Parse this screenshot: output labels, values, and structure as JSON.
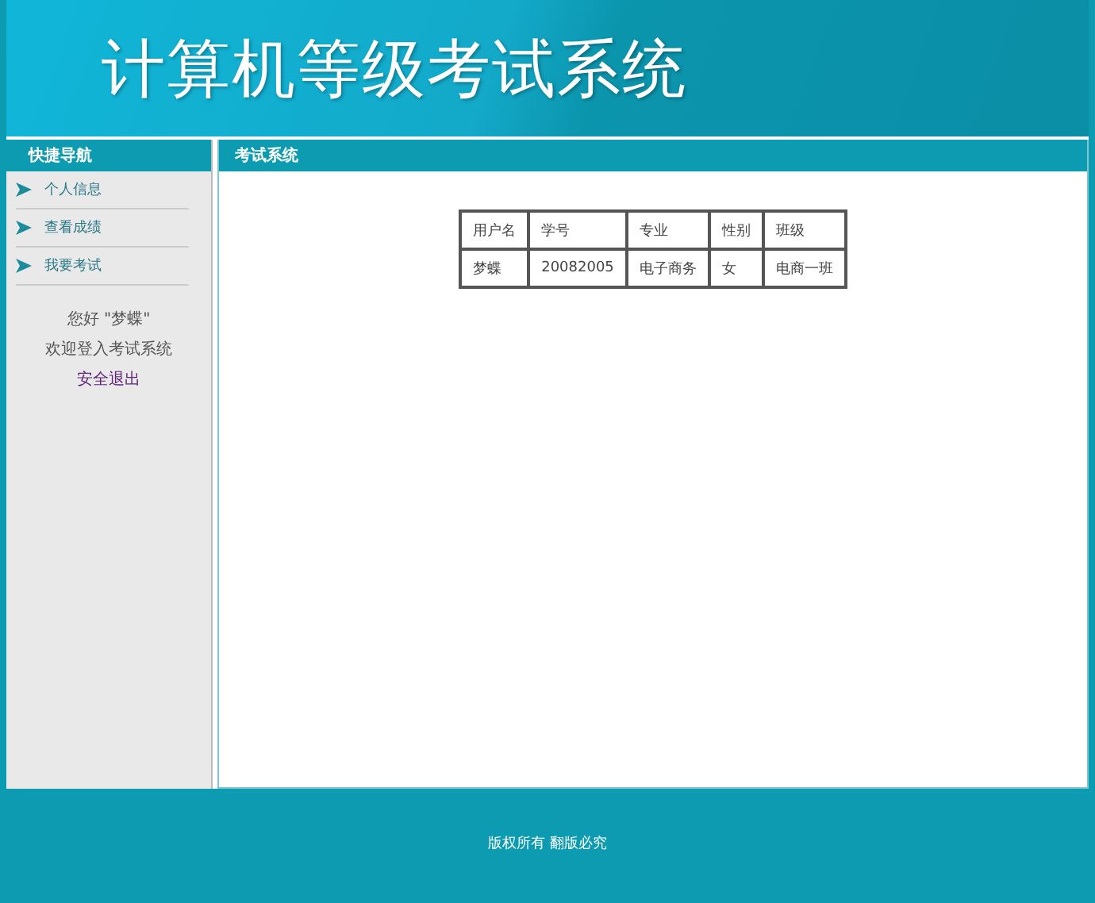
{
  "header": {
    "title": "计算机等级考试系统"
  },
  "sidebar": {
    "title": "快捷导航",
    "items": [
      {
        "label": "个人信息"
      },
      {
        "label": "查看成绩"
      },
      {
        "label": "我要考试"
      }
    ],
    "greeting": "您好 \"梦蝶\"",
    "welcome": "欢迎登入考试系统",
    "logout": "安全退出"
  },
  "main": {
    "title": "考试系统",
    "table": {
      "columns": [
        "用户名",
        "学号",
        "专业",
        "性别",
        "班级"
      ],
      "rows": [
        [
          "梦蝶",
          "20082005",
          "电子商务",
          "女",
          "电商一班"
        ]
      ]
    }
  },
  "footer": {
    "text": "版权所有 翻版必究"
  }
}
